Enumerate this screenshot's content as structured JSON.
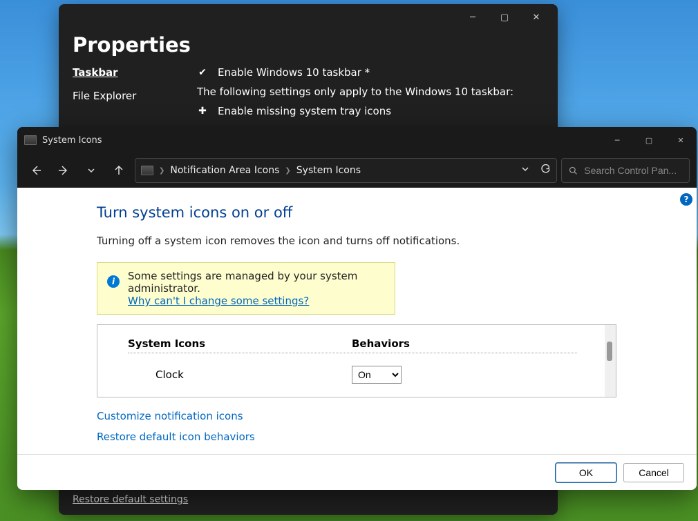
{
  "properties": {
    "title": "Properties",
    "sidebar": [
      {
        "label": "Taskbar",
        "active": true
      },
      {
        "label": "File Explorer",
        "active": false
      }
    ],
    "row1": "Enable Windows 10 taskbar *",
    "note": "The following settings only apply to the Windows 10 taskbar:",
    "row2": "Enable missing system tray icons",
    "footer_link": "Restore default settings"
  },
  "sysicons": {
    "window_title": "System Icons",
    "breadcrumb": [
      "Notification Area Icons",
      "System Icons"
    ],
    "search_placeholder": "Search Control Pan...",
    "heading": "Turn system icons on or off",
    "description": "Turning off a system icon removes the icon and turns off notifications.",
    "banner": {
      "text": "Some settings are managed by your system administrator.",
      "link": "Why can't I change some settings?"
    },
    "table": {
      "col_a": "System Icons",
      "col_b": "Behaviors",
      "rows": [
        {
          "name": "Clock",
          "value": "On"
        }
      ]
    },
    "link_customize": "Customize notification icons",
    "link_restore": "Restore default icon behaviors",
    "btn_ok": "OK",
    "btn_cancel": "Cancel"
  }
}
